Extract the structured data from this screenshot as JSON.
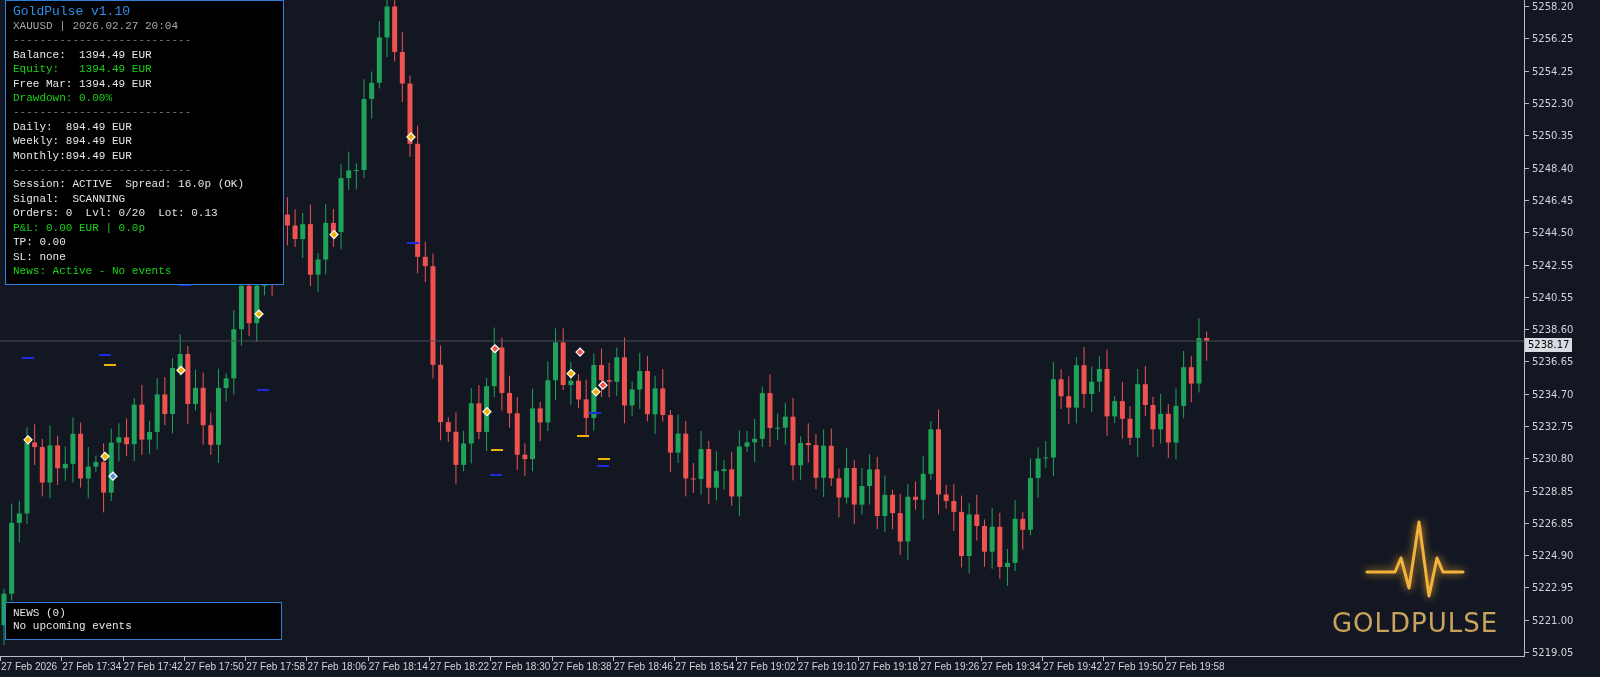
{
  "info_panel": {
    "title": "GoldPulse v1.10",
    "lines": [
      {
        "kind": "muted",
        "text": "XAUUSD | 2026.02.27 20:04"
      },
      {
        "kind": "rule",
        "text": "---------------------------"
      },
      {
        "kind": "normal",
        "text": "Balance:  1394.49 EUR"
      },
      {
        "kind": "positive",
        "text": "Equity:   1394.49 EUR"
      },
      {
        "kind": "normal",
        "text": "Free Mar: 1394.49 EUR"
      },
      {
        "kind": "positive",
        "text": "Drawdown: 0.00%"
      },
      {
        "kind": "rule",
        "text": "---------------------------"
      },
      {
        "kind": "normal",
        "text": "Daily:  894.49 EUR"
      },
      {
        "kind": "normal",
        "text": "Weekly: 894.49 EUR"
      },
      {
        "kind": "normal",
        "text": "Monthly:894.49 EUR"
      },
      {
        "kind": "rule",
        "text": "---------------------------"
      },
      {
        "kind": "normal",
        "text": "Session: ACTIVE  Spread: 16.0p (OK)"
      },
      {
        "kind": "normal",
        "text": "Signal:  SCANNING"
      },
      {
        "kind": "normal",
        "text": "Orders: 0  Lvl: 0/20  Lot: 0.13"
      },
      {
        "kind": "positive",
        "text": "P&L: 0.00 EUR | 0.0p"
      },
      {
        "kind": "normal",
        "text": "TP: 0.00"
      },
      {
        "kind": "normal",
        "text": "SL: none"
      },
      {
        "kind": "positive",
        "text": "News: Active - No events"
      }
    ]
  },
  "news_panel": {
    "title": "NEWS (0)",
    "message": "No upcoming events"
  },
  "price_axis": {
    "labels": [
      "5258.20",
      "5256.25",
      "5254.25",
      "5252.30",
      "5250.35",
      "5248.40",
      "5246.45",
      "5244.50",
      "5242.55",
      "5240.55",
      "5238.60",
      "5236.65",
      "5234.70",
      "5232.75",
      "5230.80",
      "5228.85",
      "5226.85",
      "5224.90",
      "5222.95",
      "5221.00",
      "5219.05"
    ],
    "current_price": "5238.17"
  },
  "time_axis": {
    "labels": [
      "27 Feb 2026",
      "27 Feb 17:34",
      "27 Feb 17:42",
      "27 Feb 17:50",
      "27 Feb 17:58",
      "27 Feb 18:06",
      "27 Feb 18:14",
      "27 Feb 18:22",
      "27 Feb 18:30",
      "27 Feb 18:38",
      "27 Feb 18:46",
      "27 Feb 18:54",
      "27 Feb 19:02",
      "27 Feb 19:10",
      "27 Feb 19:18",
      "27 Feb 19:26",
      "27 Feb 19:34",
      "27 Feb 19:42",
      "27 Feb 19:50",
      "27 Feb 19:58"
    ]
  },
  "logo": {
    "text": "GOLDPULSE"
  }
}
